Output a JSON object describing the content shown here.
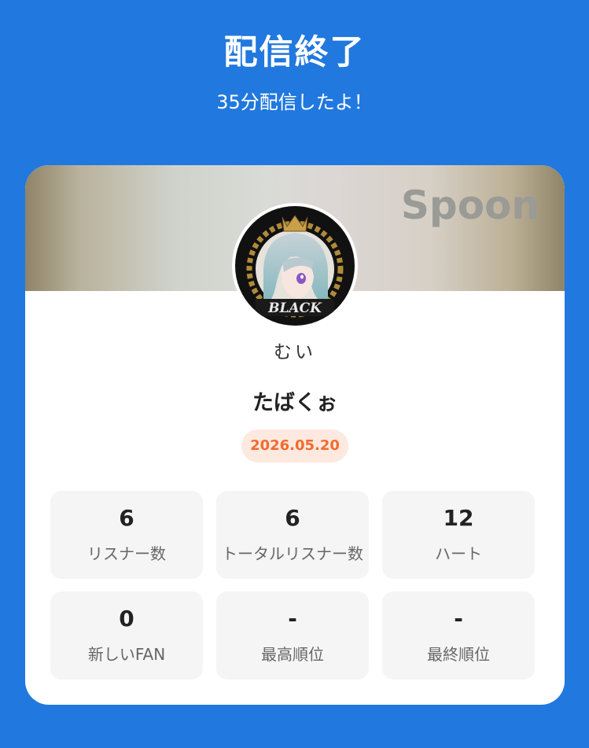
{
  "header": {
    "title": "配信終了",
    "subtitle": "35分配信したよ！"
  },
  "card": {
    "brand": "Spoon",
    "avatar_badge_text": "BLACK",
    "user_handle": "むい",
    "stream_title": "たばくぉ",
    "date": "2026.05.20"
  },
  "stats": [
    {
      "value": "6",
      "label": "リスナー数"
    },
    {
      "value": "6",
      "label": "トータルリスナー数"
    },
    {
      "value": "12",
      "label": "ハート"
    },
    {
      "value": "0",
      "label": "新しいFAN"
    },
    {
      "value": "-",
      "label": "最高順位"
    },
    {
      "value": "-",
      "label": "最終順位"
    }
  ],
  "colors": {
    "background": "#2178de",
    "date_accent": "#f26b2c",
    "date_badge_bg": "#fde9e0"
  }
}
